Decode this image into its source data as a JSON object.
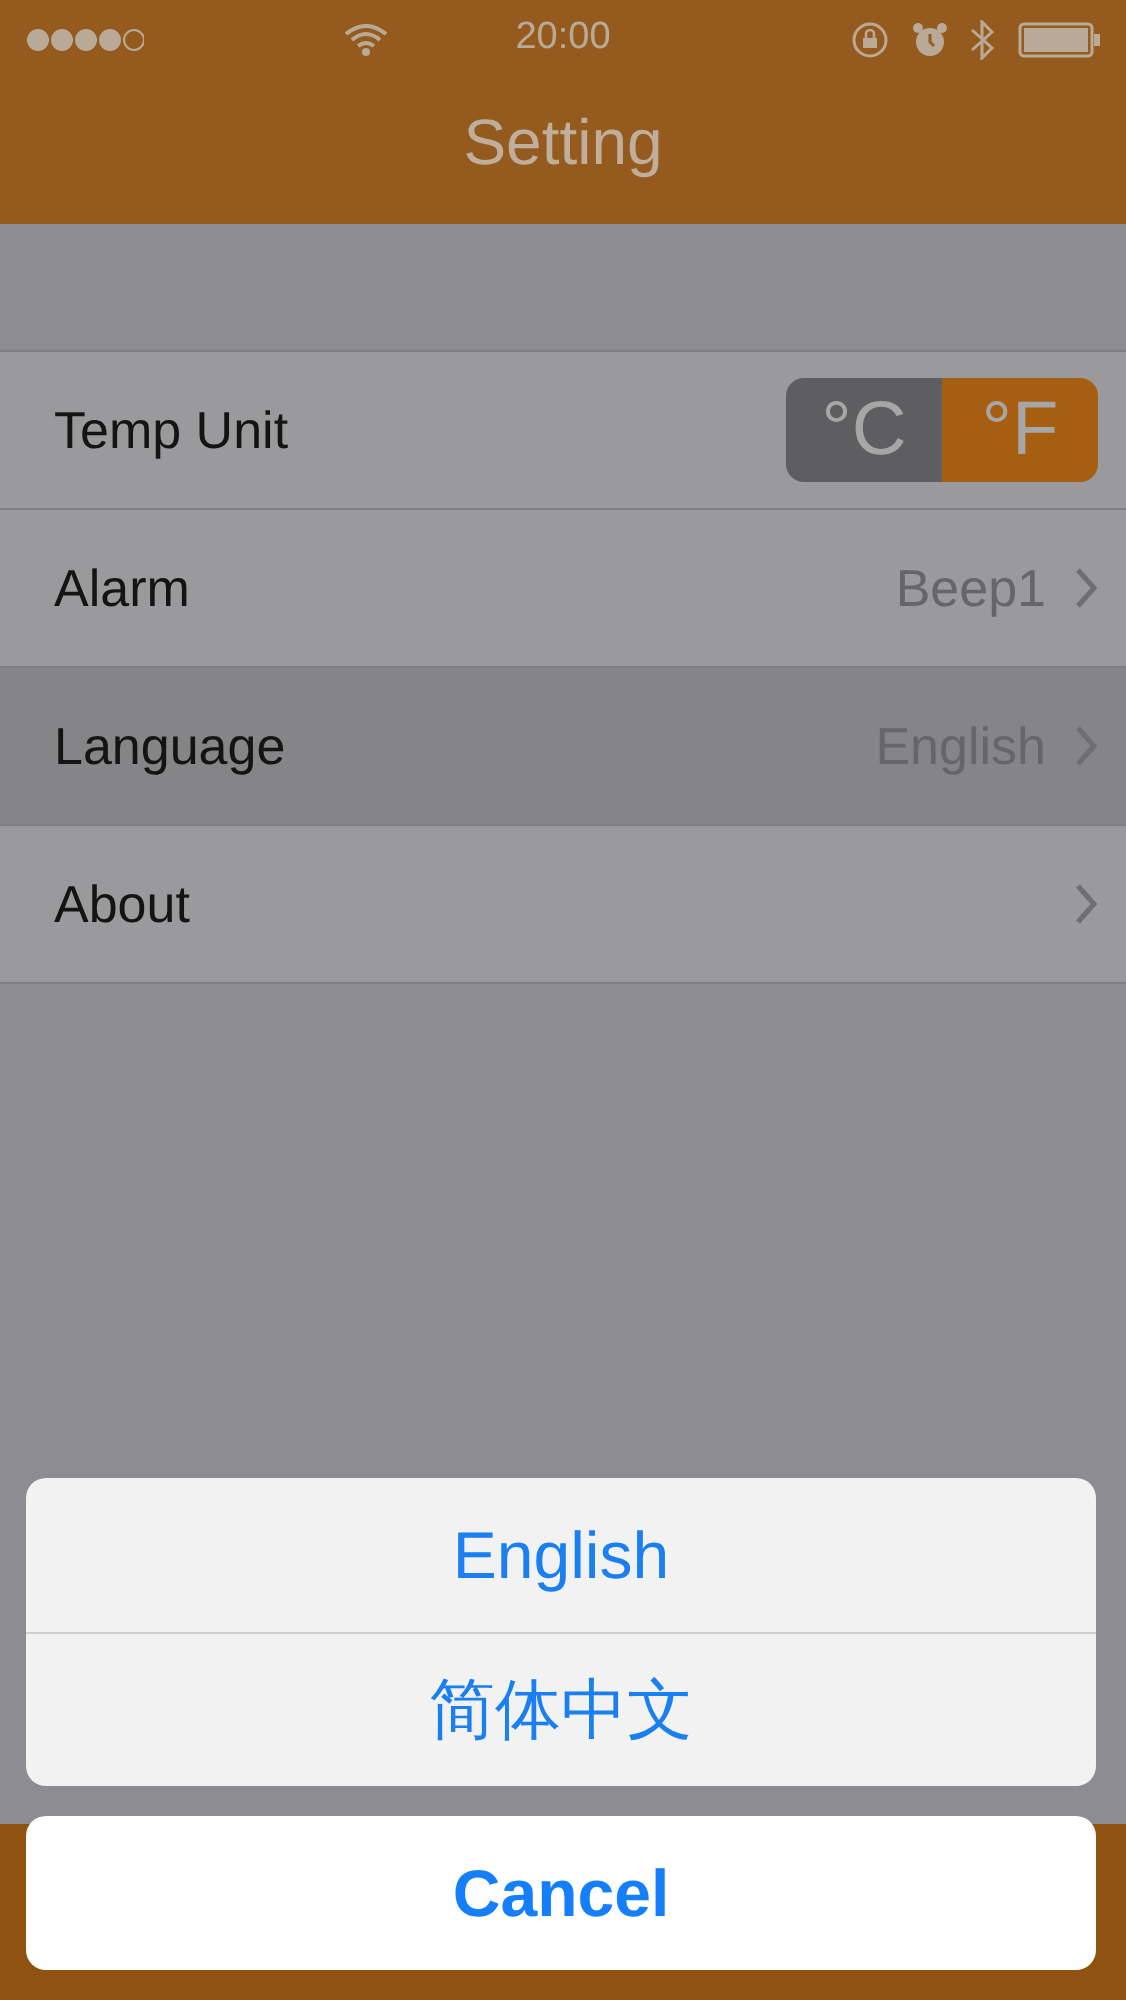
{
  "status_bar": {
    "time": "20:00"
  },
  "nav_bar": {
    "title": "Setting"
  },
  "settings": [
    {
      "kind": "segmented",
      "label": "Temp Unit",
      "selected": false,
      "options": [
        {
          "label": "°C",
          "selected": false
        },
        {
          "label": "°F",
          "selected": true
        }
      ]
    },
    {
      "kind": "detail",
      "label": "Alarm",
      "value": "Beep1",
      "selected": false
    },
    {
      "kind": "detail",
      "label": "Language",
      "value": "English",
      "selected": true
    },
    {
      "kind": "detail",
      "label": "About",
      "selected": false
    }
  ],
  "action_sheet": {
    "options": [
      "English",
      "简体中文"
    ],
    "cancel": "Cancel"
  }
}
